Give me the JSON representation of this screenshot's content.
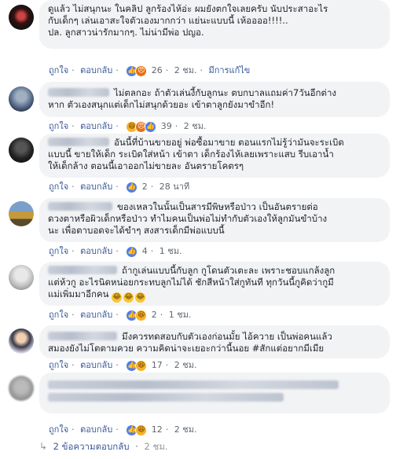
{
  "actions": {
    "like": "ถูกใจ",
    "reply": "ตอบกลับ",
    "see_translation": "มีการแก้ไข"
  },
  "comments": [
    {
      "text_lines": [
        "ดูแล้ว ไม่สนุกนะ ในคลิป ลูกร้องไห้อ่ะ ผมยังตกใจเลยครับ นับประสาอะไร",
        "กับเด็กๆ เล่นเอาสะใจตัวเองมากกว่า แย่นะแบบนี้ เห้ออออ!!!!..",
        "ปล. ลูกสาวน่ารักมากๆ. ไม่น่ามีพ่อ ปญอ."
      ],
      "react_count": "26",
      "time": "2 ชม.",
      "edited": "มีการแก้ไข",
      "reactions": [
        "like",
        "angry"
      ]
    },
    {
      "text_lines": [
        "ไม่ตลกอะ ถ้าตัวเล่นงี้กับลูกนะ ตบกบาลแถมค่า7วันอีกต่าง",
        "หาก ตัวเองสนุกแต่เด็กไม่สนุกด้วยอะ เข้าตาลูกยังมาขำอีก!"
      ],
      "react_count": "39",
      "time": "2 ชม.",
      "reactions": [
        "haha",
        "angry",
        "like"
      ]
    },
    {
      "text_lines": [
        "อันนี้ที่บ้านขายอยู่ พ่อซื้อมาขาย ตอนแรกไม่รู้ว่ามันจะระเบิด",
        "แบบนี้ ขายให้เด็ก ระเบิดใส่หน้า เข้าตา เด็กร้องไห้เลยเพราะแสบ รีบเอาน้ำ",
        "ให้เด็กล้าง ตอนนี้เอาออกไม่ขายละ อันตรายโคตรๆ"
      ],
      "react_count": "2",
      "time": "28 นาที",
      "reactions": [
        "like"
      ]
    },
    {
      "text_lines": [
        "ของเหลวในนั้นเป็นสารมีพิษหรือป่าว เป็นอันตรายต่อ",
        "ดวงตาหรือผิวเด็กหรือป่าว ทำไมคนเป็นพ่อไม่ทำกับตัวเองให้ลูกมันขำบ้าง",
        "นะ เพื่อตาบอดจะได้ขำๆ สงสารเด็กมีพ่อแบบนี้"
      ],
      "react_count": "4",
      "time": "1 ชม.",
      "reactions": [
        "like"
      ]
    },
    {
      "text_lines": [
        "ถ้ากูเล่นแบบนี้กับลูก กูโดนตัวเตะละ เพราะชอบแกล้งลูก",
        "แต่ห้วกู อะไรนิดหน่อยกระทบลูกไม่ได้ ชักสีหน้าใส่กูทันที ทุกวันนี้กูคิดว่ากูมี",
        "แม่เพิ่มมาอีกคน"
      ],
      "react_count": "2",
      "time": "1 ชม.",
      "reactions": [
        "like",
        "haha"
      ]
    },
    {
      "text_lines": [
        "มึงควรทดสอบกับตัวเองก่อนมั้ย ไอ้ควาย เป็นพ่อคนแล้ว",
        "สมองยังไม่โตตามควย ความคิดน่าจะเยอะกว่านี้นอย #สักแต่อยากมีเมีย"
      ],
      "react_count": "17",
      "time": "2 ชม.",
      "reactions": [
        "like",
        "haha"
      ]
    },
    {
      "text_lines": [
        "",
        ""
      ],
      "react_count": "12",
      "time": "2 ชม.",
      "reactions": [
        "like",
        "haha"
      ]
    }
  ],
  "replies_link": {
    "label": "2 ข้อความตอบกลับ",
    "time": "2 ชม."
  }
}
